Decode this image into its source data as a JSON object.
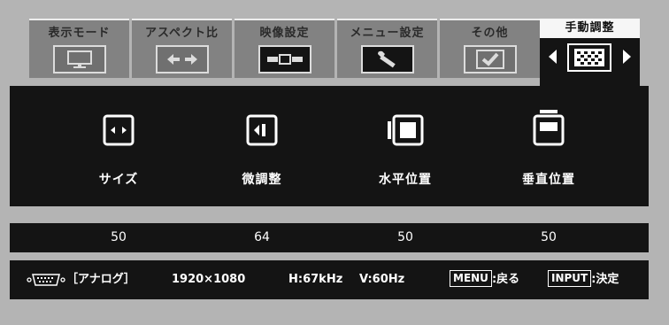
{
  "tabs": [
    {
      "label": "表示モード",
      "icon": "monitor-icon",
      "active": false
    },
    {
      "label": "アスペクト比",
      "icon": "aspect-arrows-icon",
      "active": false
    },
    {
      "label": "映像設定",
      "icon": "picture-settings-icon",
      "active": false
    },
    {
      "label": "メニュー設定",
      "icon": "wrench-icon",
      "active": false
    },
    {
      "label": "その他",
      "icon": "checkmark-icon",
      "active": false
    },
    {
      "label": "手動調整",
      "icon": "pattern-grid-icon",
      "active": true
    }
  ],
  "items": [
    {
      "label": "サイズ",
      "icon": "size-icon"
    },
    {
      "label": "微調整",
      "icon": "fine-tune-icon"
    },
    {
      "label": "水平位置",
      "icon": "horizontal-position-icon"
    },
    {
      "label": "垂直位置",
      "icon": "vertical-position-icon"
    }
  ],
  "values": [
    "50",
    "64",
    "50",
    "50"
  ],
  "status": {
    "input_source": "［アナログ］",
    "resolution": "1920×1080",
    "h_freq": "H:67kHz",
    "v_freq": "V:60Hz",
    "menu_key": "MENU",
    "menu_action": ":戻る",
    "input_key": "INPUT",
    "input_action": ":決定"
  },
  "colors": {
    "panel": "#141414",
    "frame": "#b4b4b4",
    "tab_inactive": "#828282",
    "text": "#ffffff"
  }
}
